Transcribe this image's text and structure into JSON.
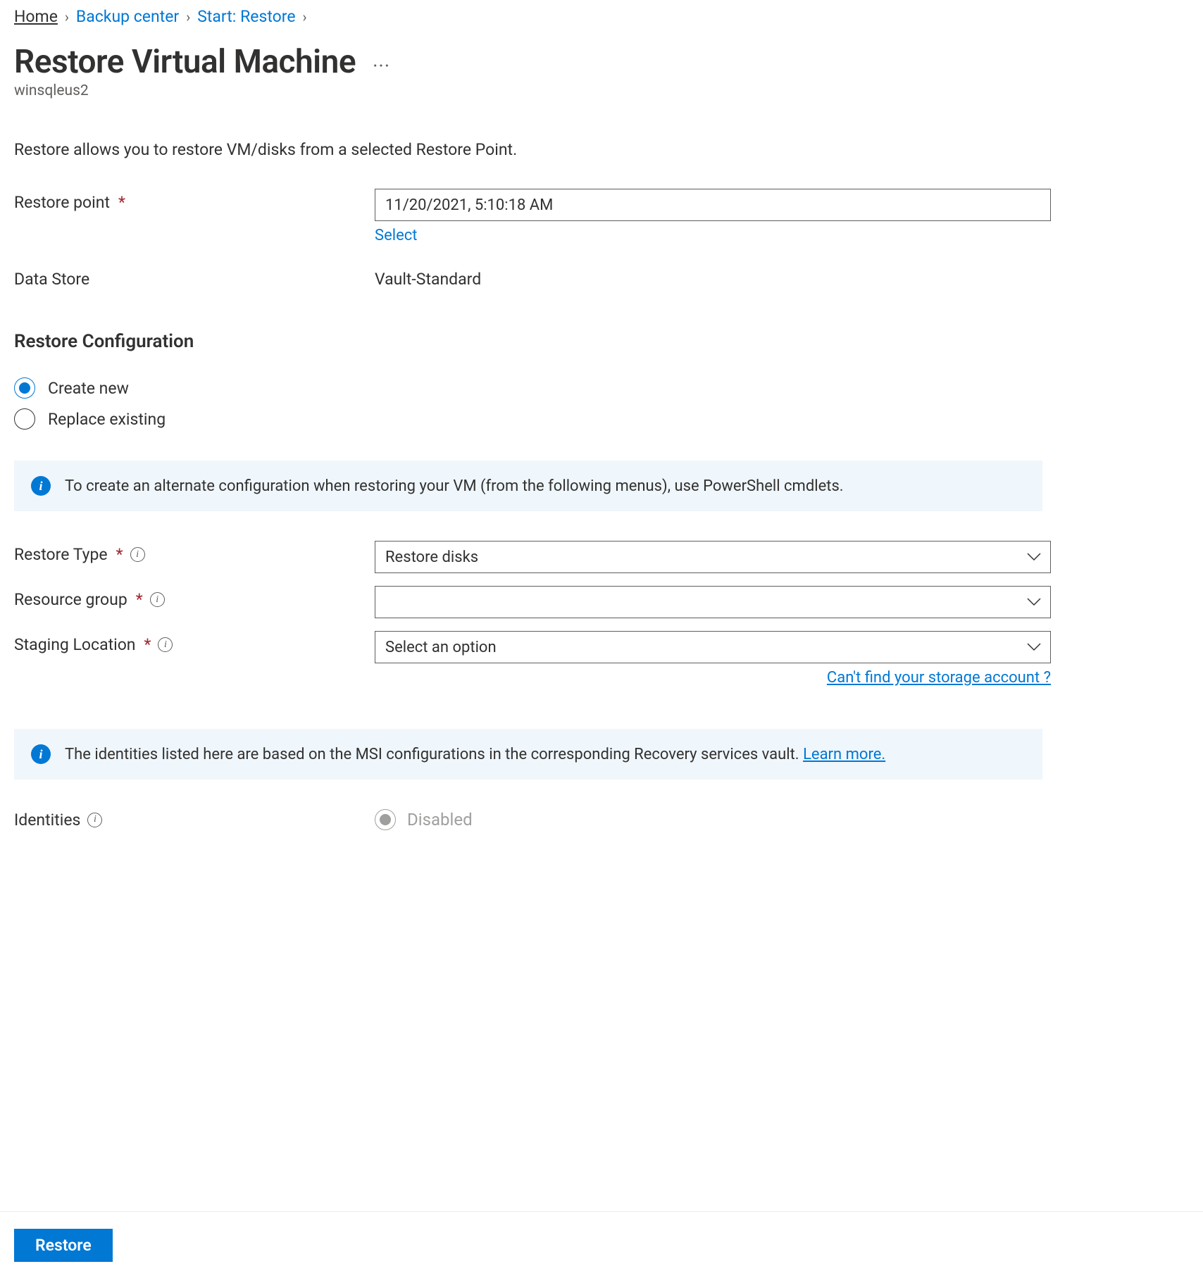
{
  "breadcrumb": {
    "home": "Home",
    "backup_center": "Backup center",
    "start_restore": "Start: Restore"
  },
  "header": {
    "title": "Restore Virtual Machine",
    "subtitle": "winsqleus2"
  },
  "description": "Restore allows you to restore VM/disks from a selected Restore Point.",
  "fields": {
    "restore_point_label": "Restore point",
    "restore_point_value": "11/20/2021, 5:10:18 AM",
    "select_link": "Select",
    "data_store_label": "Data Store",
    "data_store_value": "Vault-Standard",
    "restore_type_label": "Restore Type",
    "restore_type_value": "Restore disks",
    "resource_group_label": "Resource group",
    "resource_group_value": "",
    "staging_location_label": "Staging Location",
    "staging_location_value": "Select an option",
    "storage_help": "Can't find your storage account ?",
    "identities_label": "Identities",
    "identities_value": "Disabled"
  },
  "section": {
    "restore_config": "Restore Configuration"
  },
  "radios": {
    "create_new": "Create new",
    "replace_existing": "Replace existing"
  },
  "banners": {
    "powershell": "To create an alternate configuration when restoring your VM (from the following menus), use PowerShell cmdlets.",
    "identities_prefix": "The identities listed here are based on the MSI configurations in the corresponding Recovery services vault. ",
    "learn_more": "Learn more."
  },
  "footer": {
    "restore_button": "Restore"
  }
}
